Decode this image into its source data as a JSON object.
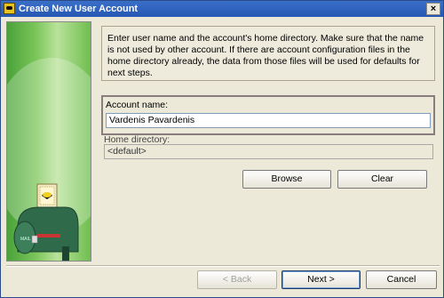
{
  "window": {
    "title": "Create New User Account",
    "close_glyph": "×"
  },
  "info": {
    "text": "Enter user name and the account's home directory. Make sure that the name is not used by other account. If there are account configuration files in the home directory already, the data from those files will be used for defaults for next steps."
  },
  "account": {
    "label": "Account name:",
    "value": "Vardenis Pavardenis"
  },
  "home": {
    "label": "Home directory:",
    "value": "<default>"
  },
  "buttons": {
    "browse": "Browse",
    "clear": "Clear",
    "back": "< Back",
    "next": "Next >",
    "cancel": "Cancel"
  },
  "colors": {
    "titlebar": "#2557b3",
    "side_panel": "#7cc65a",
    "mailbox": "#2f6a4a",
    "flag": "#d33"
  },
  "icons": {
    "app": "bat-logo-icon",
    "side": "mailbox-illustration-icon"
  }
}
